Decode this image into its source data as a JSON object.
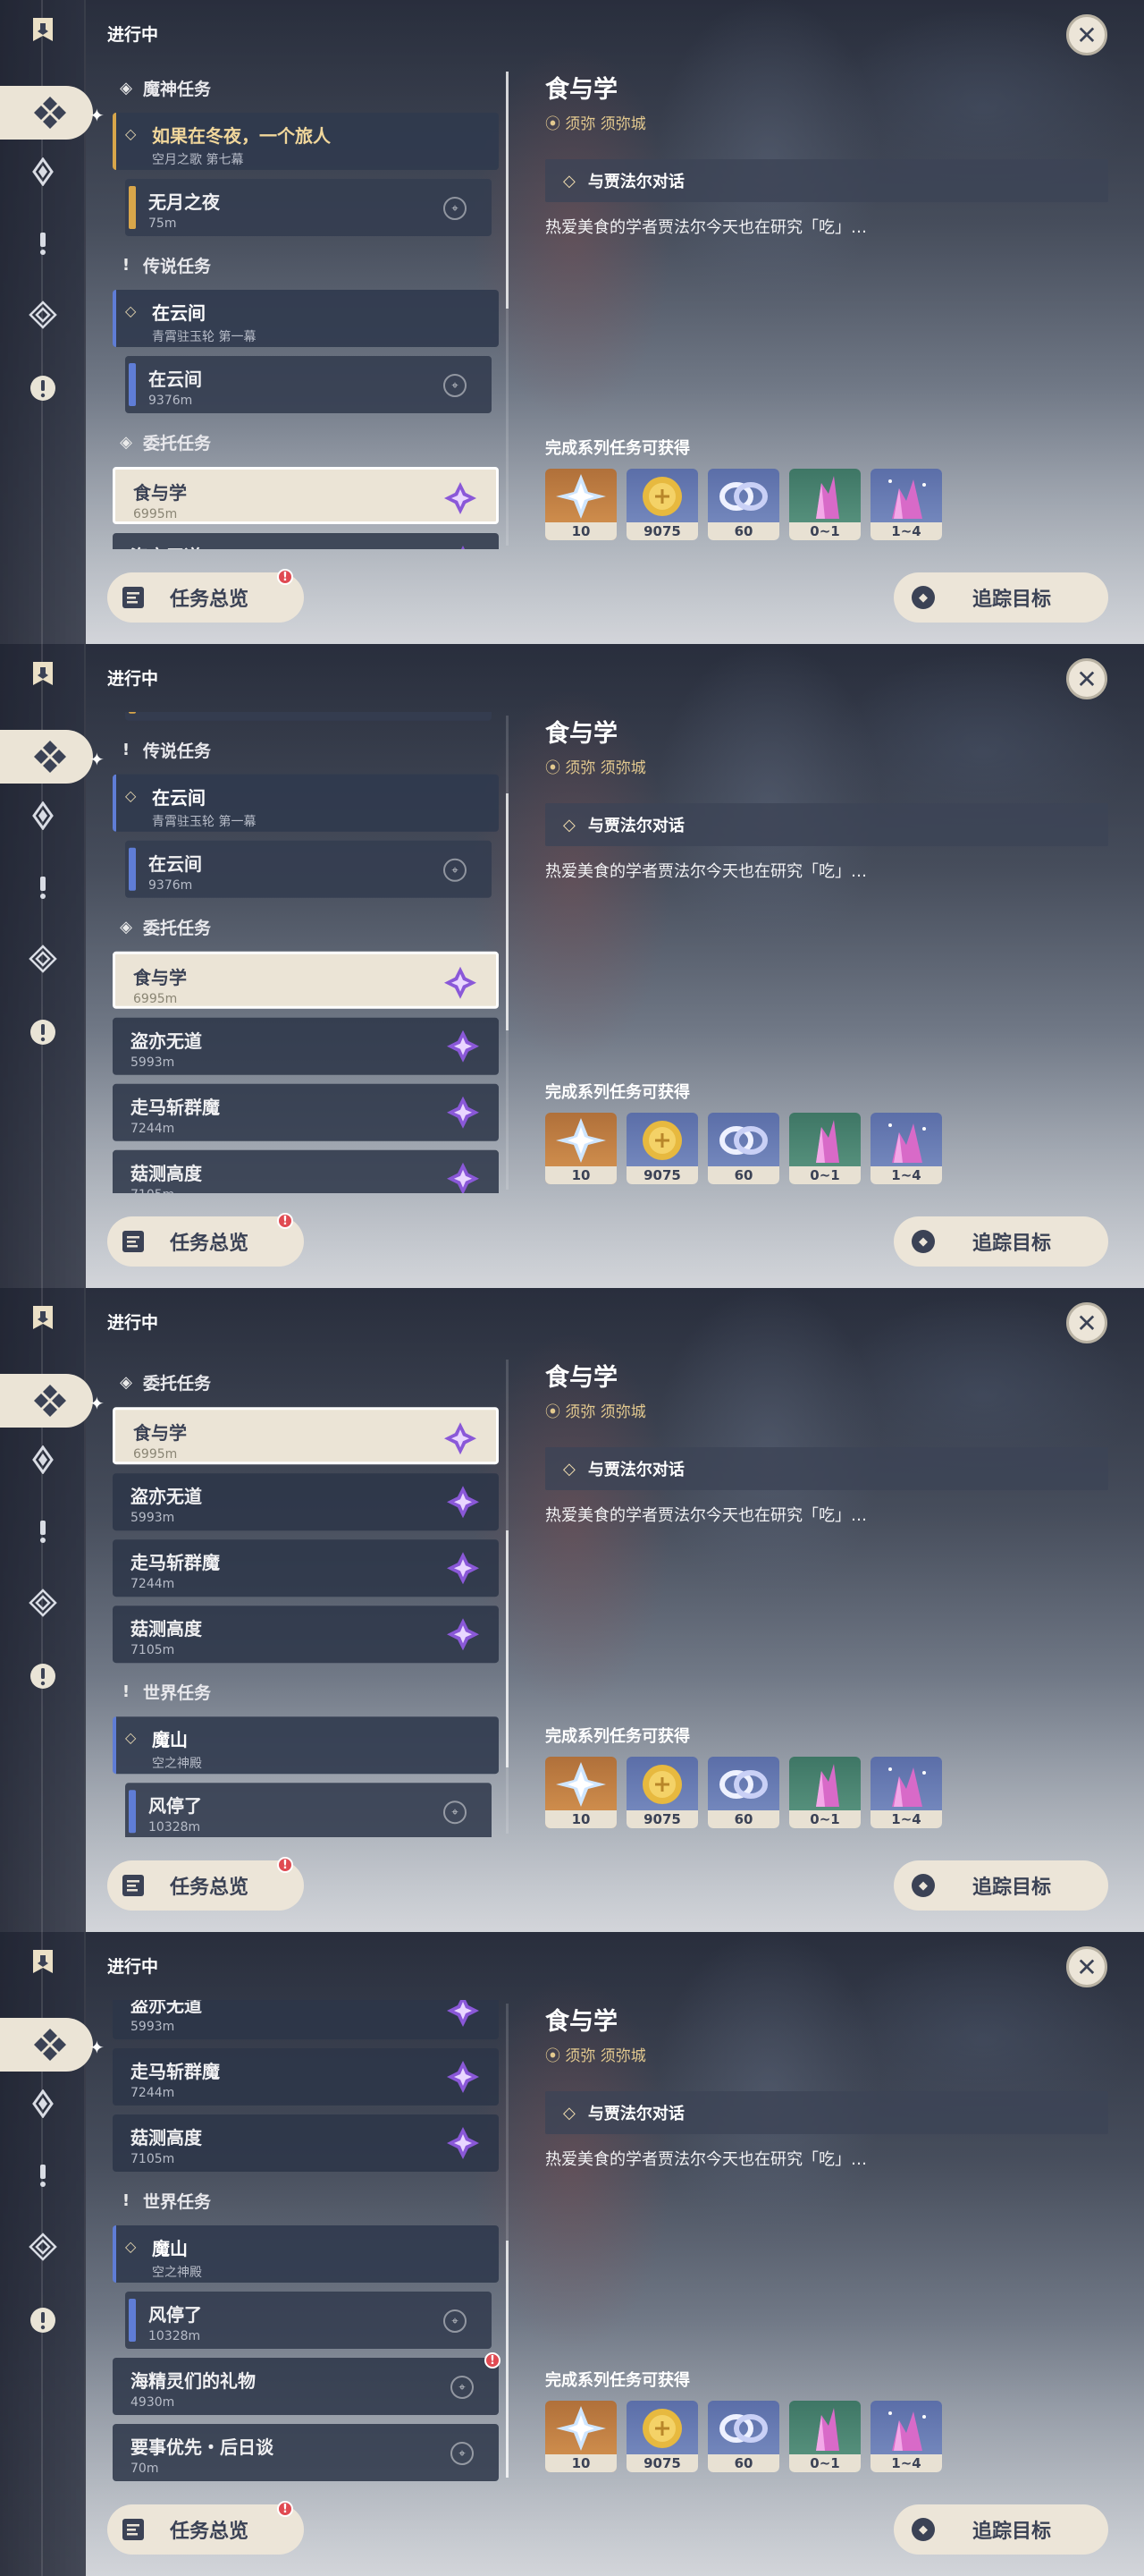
{
  "colors": {
    "accent_gold": "#d8a64a",
    "accent_blue": "#5f7dd6",
    "panel_cream": "#ece5d8",
    "alert_red": "#e04a52"
  },
  "header": {
    "label": "进行中",
    "close_icon": "close-icon"
  },
  "rail_icons": [
    "quest-banner-icon",
    "archon-quest-icon",
    "story-quest-icon",
    "world-quest-icon",
    "commission-quest-icon",
    "event-quest-icon"
  ],
  "sections": {
    "archon": "魔神任务",
    "story": "传说任务",
    "commission": "委托任务",
    "world": "世界任务"
  },
  "quests": {
    "winter_night": {
      "title": "如果在冬夜，一个旅人",
      "subtitle": "空月之歌 第七幕"
    },
    "moonless": {
      "title": "无月之夜",
      "distance": "75m"
    },
    "cloud_main": {
      "title": "在云间",
      "subtitle": "青霄驻玉轮 第一幕"
    },
    "cloud_sub": {
      "title": "在云间",
      "distance": "9376m"
    },
    "food": {
      "title": "食与学",
      "distance": "6995m"
    },
    "thief": {
      "title": "盗亦无道",
      "distance": "5993m"
    },
    "horse": {
      "title": "走马斩群魔",
      "distance": "7244m"
    },
    "mushroom": {
      "title": "菇测高度",
      "distance": "7105m"
    },
    "mountain": {
      "title": "魔山",
      "subtitle": "空之神殿"
    },
    "wind": {
      "title": "风停了",
      "distance": "10328m"
    },
    "sprite": {
      "title": "海精灵们的礼物",
      "distance": "4930m"
    },
    "priority": {
      "title": "要事优先・后日谈",
      "distance": "70m"
    }
  },
  "footer": {
    "overview_label": "任务总览",
    "track_label": "追踪目标",
    "alert": "!"
  },
  "detail": {
    "title": "食与学",
    "location": "须弥 须弥城",
    "objective": "与贾法尔对话",
    "description": "热爱美食的学者贾法尔今天也在研究「吃」…",
    "rewards_title": "完成系列任务可获得",
    "rewards": [
      {
        "icon": "adventure-exp-icon",
        "count": "10"
      },
      {
        "icon": "mora-icon",
        "count": "9075"
      },
      {
        "icon": "companionship-exp-icon",
        "count": "60"
      },
      {
        "icon": "crystal-ore-icon",
        "count": "0~1"
      },
      {
        "icon": "crystal-chunk-icon",
        "count": "1~4"
      }
    ]
  },
  "frames": [
    {
      "scroll": 0.0
    },
    {
      "scroll": 0.33
    },
    {
      "scroll": 0.72
    },
    {
      "scroll": 1.0
    }
  ]
}
